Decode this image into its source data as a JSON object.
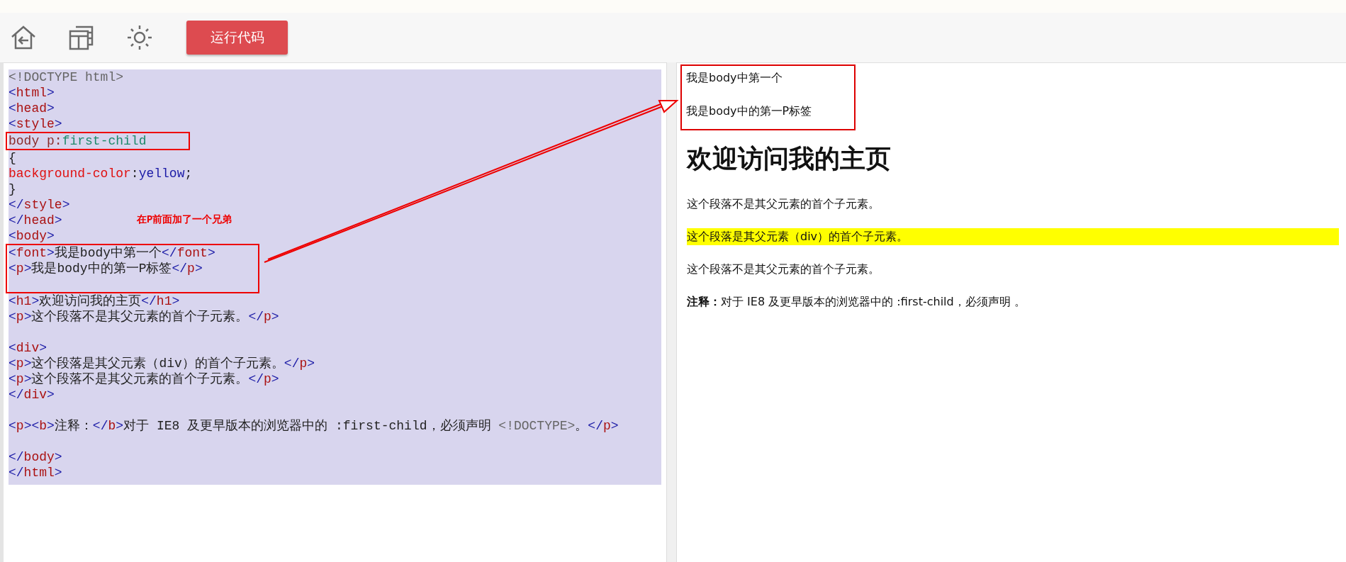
{
  "toolbar": {
    "run_button": "运行代码"
  },
  "editor": {
    "note": "在P前面加了一个兄弟",
    "blocks": [
      {
        "boxed": false,
        "lines": [
          {
            "kind": "code",
            "tokens": [
              {
                "kind": "doctype",
                "text": "<!DOCTYPE html>"
              }
            ]
          },
          {
            "kind": "code",
            "tokens": [
              {
                "kind": "punct",
                "text": "<"
              },
              {
                "kind": "tag",
                "text": "html"
              },
              {
                "kind": "punct",
                "text": ">"
              }
            ]
          },
          {
            "kind": "code",
            "tokens": [
              {
                "kind": "punct",
                "text": "<"
              },
              {
                "kind": "tag",
                "text": "head"
              },
              {
                "kind": "punct",
                "text": ">"
              }
            ]
          },
          {
            "kind": "code",
            "tokens": [
              {
                "kind": "punct",
                "text": "<"
              },
              {
                "kind": "tag",
                "text": "style"
              },
              {
                "kind": "punct",
                "text": ">"
              }
            ]
          }
        ]
      },
      {
        "boxed": true,
        "lines": [
          {
            "kind": "code",
            "tokens": [
              {
                "kind": "selector",
                "text": "body p:"
              },
              {
                "kind": "pseudo",
                "text": "first-child"
              }
            ]
          }
        ]
      },
      {
        "boxed": false,
        "lines": [
          {
            "kind": "code",
            "tokens": [
              {
                "kind": "plain",
                "text": "{"
              }
            ]
          },
          {
            "kind": "code",
            "tokens": [
              {
                "kind": "prop",
                "text": "background-color"
              },
              {
                "kind": "plain",
                "text": ":"
              },
              {
                "kind": "value",
                "text": "yellow"
              },
              {
                "kind": "plain",
                "text": ";"
              }
            ]
          },
          {
            "kind": "code",
            "tokens": [
              {
                "kind": "plain",
                "text": "}"
              }
            ]
          },
          {
            "kind": "code",
            "tokens": [
              {
                "kind": "punct",
                "text": "</"
              },
              {
                "kind": "tag",
                "text": "style"
              },
              {
                "kind": "punct",
                "text": ">"
              }
            ]
          },
          {
            "kind": "code",
            "tokens": [
              {
                "kind": "punct",
                "text": "</"
              },
              {
                "kind": "tag",
                "text": "head"
              },
              {
                "kind": "punct",
                "text": ">"
              }
            ]
          },
          {
            "kind": "code",
            "tokens": [
              {
                "kind": "punct",
                "text": "<"
              },
              {
                "kind": "tag",
                "text": "body"
              },
              {
                "kind": "punct",
                "text": ">"
              }
            ]
          }
        ]
      },
      {
        "boxed": true,
        "lines": [
          {
            "kind": "code",
            "tokens": [
              {
                "kind": "punct",
                "text": "<"
              },
              {
                "kind": "tag",
                "text": "font"
              },
              {
                "kind": "punct",
                "text": ">"
              },
              {
                "kind": "plain",
                "text": "我是body中第一个"
              },
              {
                "kind": "punct",
                "text": "</"
              },
              {
                "kind": "tag",
                "text": "font"
              },
              {
                "kind": "punct",
                "text": ">"
              }
            ]
          },
          {
            "kind": "code",
            "tokens": [
              {
                "kind": "punct",
                "text": "<"
              },
              {
                "kind": "tag",
                "text": "p"
              },
              {
                "kind": "punct",
                "text": ">"
              },
              {
                "kind": "plain",
                "text": "我是body中的第一P标签"
              },
              {
                "kind": "punct",
                "text": "</"
              },
              {
                "kind": "tag",
                "text": "p"
              },
              {
                "kind": "punct",
                "text": ">"
              }
            ]
          },
          {
            "kind": "blank"
          }
        ]
      },
      {
        "boxed": false,
        "lines": [
          {
            "kind": "code",
            "tokens": [
              {
                "kind": "punct",
                "text": "<"
              },
              {
                "kind": "tag",
                "text": "h1"
              },
              {
                "kind": "punct",
                "text": ">"
              },
              {
                "kind": "plain",
                "text": "欢迎访问我的主页"
              },
              {
                "kind": "punct",
                "text": "</"
              },
              {
                "kind": "tag",
                "text": "h1"
              },
              {
                "kind": "punct",
                "text": ">"
              }
            ]
          },
          {
            "kind": "code",
            "tokens": [
              {
                "kind": "punct",
                "text": "<"
              },
              {
                "kind": "tag",
                "text": "p"
              },
              {
                "kind": "punct",
                "text": ">"
              },
              {
                "kind": "plain",
                "text": "这个段落不是其父元素的首个子元素。"
              },
              {
                "kind": "punct",
                "text": "</"
              },
              {
                "kind": "tag",
                "text": "p"
              },
              {
                "kind": "punct",
                "text": ">"
              }
            ]
          },
          {
            "kind": "blank"
          },
          {
            "kind": "code",
            "tokens": [
              {
                "kind": "punct",
                "text": "<"
              },
              {
                "kind": "tag",
                "text": "div"
              },
              {
                "kind": "punct",
                "text": ">"
              }
            ]
          },
          {
            "kind": "code",
            "tokens": [
              {
                "kind": "punct",
                "text": "<"
              },
              {
                "kind": "tag",
                "text": "p"
              },
              {
                "kind": "punct",
                "text": ">"
              },
              {
                "kind": "plain",
                "text": "这个段落是其父元素（div）的首个子元素。"
              },
              {
                "kind": "punct",
                "text": "</"
              },
              {
                "kind": "tag",
                "text": "p"
              },
              {
                "kind": "punct",
                "text": ">"
              }
            ]
          },
          {
            "kind": "code",
            "tokens": [
              {
                "kind": "punct",
                "text": "<"
              },
              {
                "kind": "tag",
                "text": "p"
              },
              {
                "kind": "punct",
                "text": ">"
              },
              {
                "kind": "plain",
                "text": "这个段落不是其父元素的首个子元素。"
              },
              {
                "kind": "punct",
                "text": "</"
              },
              {
                "kind": "tag",
                "text": "p"
              },
              {
                "kind": "punct",
                "text": ">"
              }
            ]
          },
          {
            "kind": "code",
            "tokens": [
              {
                "kind": "punct",
                "text": "</"
              },
              {
                "kind": "tag",
                "text": "div"
              },
              {
                "kind": "punct",
                "text": ">"
              }
            ]
          },
          {
            "kind": "blank"
          },
          {
            "kind": "code",
            "tokens": [
              {
                "kind": "punct",
                "text": "<"
              },
              {
                "kind": "tag",
                "text": "p"
              },
              {
                "kind": "punct",
                "text": "><"
              },
              {
                "kind": "tag",
                "text": "b"
              },
              {
                "kind": "punct",
                "text": ">"
              },
              {
                "kind": "plain",
                "text": "注释："
              },
              {
                "kind": "punct",
                "text": "</"
              },
              {
                "kind": "tag",
                "text": "b"
              },
              {
                "kind": "punct",
                "text": ">"
              },
              {
                "kind": "plain",
                "text": "对于 IE8 及更早版本的浏览器中的 :first-child，必须声明 "
              },
              {
                "kind": "doctype",
                "text": "<!DOCTYPE>"
              },
              {
                "kind": "plain",
                "text": "。"
              },
              {
                "kind": "punct",
                "text": "</"
              },
              {
                "kind": "tag",
                "text": "p"
              },
              {
                "kind": "punct",
                "text": ">"
              }
            ]
          },
          {
            "kind": "blank"
          },
          {
            "kind": "code",
            "tokens": [
              {
                "kind": "punct",
                "text": "</"
              },
              {
                "kind": "tag",
                "text": "body"
              },
              {
                "kind": "punct",
                "text": ">"
              }
            ]
          },
          {
            "kind": "code",
            "tokens": [
              {
                "kind": "punct",
                "text": "</"
              },
              {
                "kind": "tag",
                "text": "html"
              },
              {
                "kind": "punct",
                "text": ">"
              }
            ]
          }
        ]
      }
    ]
  },
  "preview": {
    "boxed_items": [
      {
        "text": "我是body中第一个"
      },
      {
        "text": "我是body中的第一P标签"
      }
    ],
    "items": [
      {
        "kind": "h1",
        "text": "**欢迎访问我的主页**",
        "highlighted": false
      },
      {
        "kind": "p",
        "text": "这个段落不是其父元素的首个子元素。",
        "highlighted": false
      },
      {
        "kind": "p",
        "text": "这个段落是其父元素（div）的首个子元素。",
        "highlighted": true
      },
      {
        "kind": "p",
        "text": "这个段落不是其父元素的首个子元素。",
        "highlighted": false
      },
      {
        "kind": "p",
        "text": "**注释：**对于 IE8 及更早版本的浏览器中的 :first-child，必须声明 。",
        "highlighted": false
      }
    ]
  }
}
